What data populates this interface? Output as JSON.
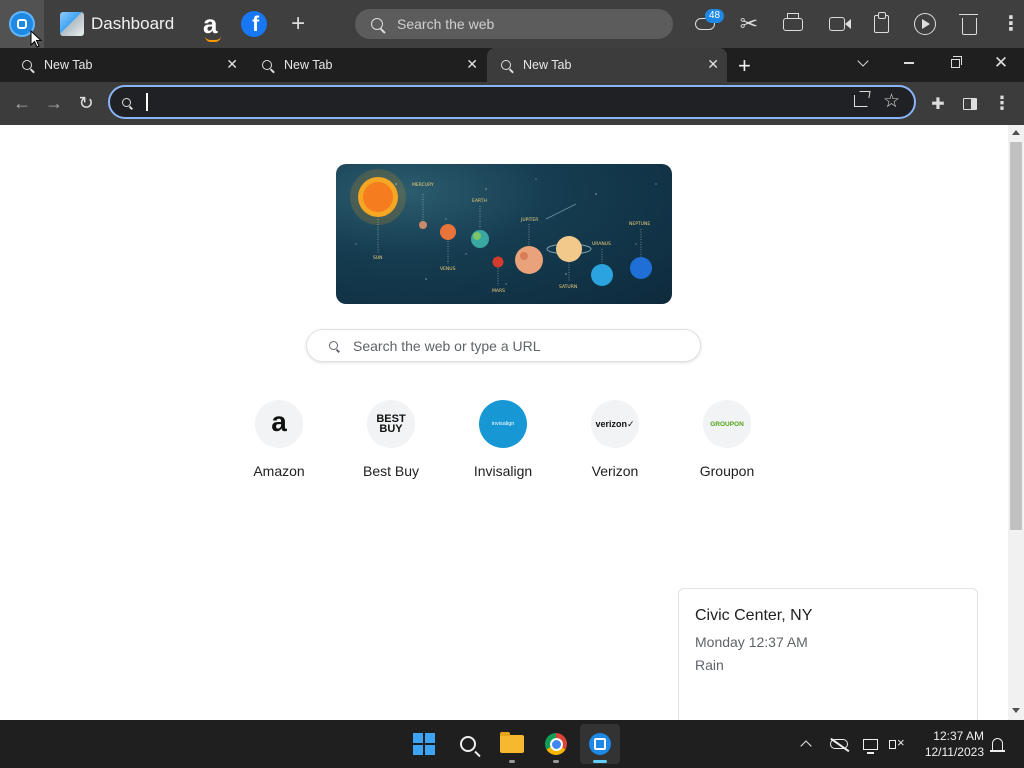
{
  "dock": {
    "dashboard_label": "Dashboard",
    "search_placeholder": "Search the web",
    "notification_count": "48",
    "icons": [
      "app-logo",
      "dashboard",
      "amazon",
      "facebook",
      "add",
      "weather-cloud",
      "scissors",
      "print",
      "video-camera",
      "clipboard",
      "play",
      "trash",
      "more"
    ]
  },
  "tabs": [
    {
      "label": "New Tab"
    },
    {
      "label": "New Tab"
    },
    {
      "label": "New Tab",
      "active": true
    }
  ],
  "toolbar": {
    "omnibox_value": "",
    "omnibox_placeholder": ""
  },
  "ntp": {
    "search_placeholder": "Search the web or type a URL",
    "shortcuts": [
      {
        "label": "Amazon",
        "logo": "a"
      },
      {
        "label": "Best Buy",
        "logo": "BEST BUY"
      },
      {
        "label": "Invisalign",
        "logo": "invisalign"
      },
      {
        "label": "Verizon",
        "logo": "verizon✓"
      },
      {
        "label": "Groupon",
        "logo": "GROUPON"
      }
    ],
    "doodle_labels": {
      "sun": "SUN",
      "mercury": "MERCURY",
      "venus": "VENUS",
      "earth": "EARTH",
      "mars": "MARS",
      "jupiter": "JUPITER",
      "saturn": "SATURN",
      "uranus": "URANUS",
      "neptune": "NEPTUNE"
    }
  },
  "weather": {
    "city": "Civic Center, NY",
    "time": "Monday 12:37 AM",
    "condition": "Rain"
  },
  "taskbar": {
    "time": "12:37 AM",
    "date": "12/11/2023"
  },
  "colors": {
    "accent": "#8ab4f8",
    "dock_bg": "#3f3f3f",
    "tabstrip_bg": "#1f1f1f",
    "toolbar_bg": "#3c3c3c"
  }
}
